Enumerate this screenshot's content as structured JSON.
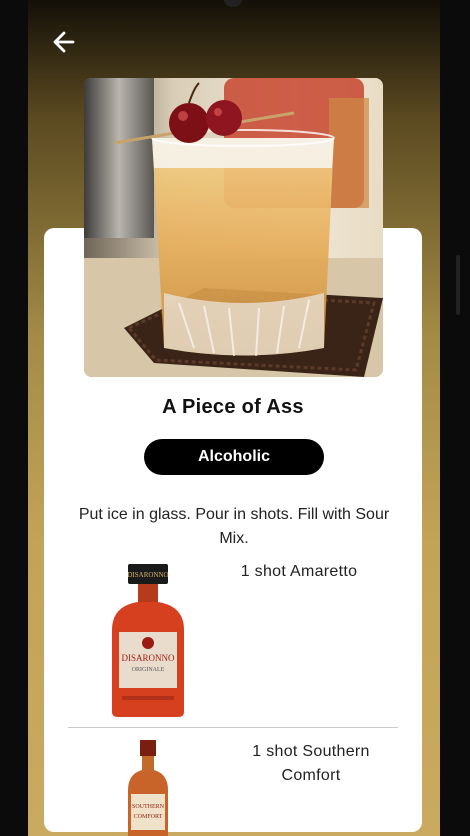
{
  "drink": {
    "name": "A Piece of Ass",
    "category": "Alcoholic",
    "instructions": "Put ice in glass. Pour in shots. Fill with Sour Mix."
  },
  "ingredients": [
    {
      "measure_text": "1 shot  Amaretto",
      "bottle_label": "DISARONNO",
      "bottle_sub": "ORIGINALE"
    },
    {
      "measure_text": "1 shot  Southern Comfort",
      "bottle_label": "SOUTHERN",
      "bottle_sub": "COMFORT"
    }
  ],
  "icons": {
    "back": "arrow-left-icon"
  },
  "colors": {
    "badge_bg": "#000000",
    "badge_text": "#ffffff",
    "gradient_top": "#141008",
    "gradient_bottom": "#c9aa60"
  }
}
